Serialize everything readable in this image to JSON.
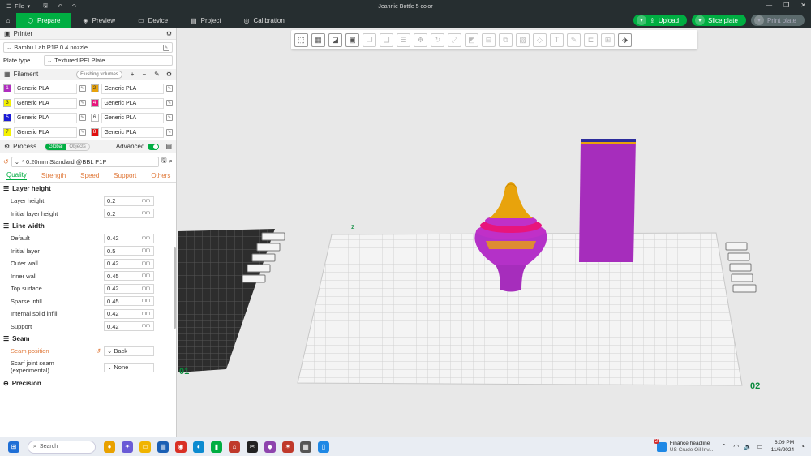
{
  "window": {
    "title": "Jeannie Bottle 5 color",
    "file_menu": "File"
  },
  "nav": {
    "tabs": [
      {
        "label": "Prepare",
        "icon": "cube-icon"
      },
      {
        "label": "Preview",
        "icon": "layers-icon"
      },
      {
        "label": "Device",
        "icon": "monitor-icon"
      },
      {
        "label": "Project",
        "icon": "project-icon"
      },
      {
        "label": "Calibration",
        "icon": "calibration-icon"
      }
    ],
    "upload": "Upload",
    "slice_plate": "Slice plate",
    "print_plate": "Print plate"
  },
  "printer": {
    "header": "Printer",
    "printer_name": "Bambu Lab P1P 0.4 nozzle",
    "plate_type_label": "Plate type",
    "plate_type_value": "Textured PEI Plate"
  },
  "filament": {
    "header": "Filament",
    "flushing": "Flushing volumes",
    "slots": [
      {
        "num": "1",
        "name": "Generic PLA",
        "color": "#b02ec0"
      },
      {
        "num": "2",
        "name": "Generic PLA",
        "color": "#e8a30c"
      },
      {
        "num": "3",
        "name": "Generic PLA",
        "color": "#f5f200"
      },
      {
        "num": "4",
        "name": "Generic PLA",
        "color": "#e8157c"
      },
      {
        "num": "5",
        "name": "Generic PLA",
        "color": "#1b1bd6"
      },
      {
        "num": "6",
        "name": "Generic PLA",
        "color": "#ffffff"
      },
      {
        "num": "7",
        "name": "Generic PLA",
        "color": "#f5f200"
      },
      {
        "num": "8",
        "name": "Generic PLA",
        "color": "#e01010"
      }
    ]
  },
  "process": {
    "header": "Process",
    "global": "Global",
    "objects": "Objects",
    "advanced": "Advanced",
    "preset": "* 0.20mm Standard @BBL P1P",
    "tabs": [
      "Quality",
      "Strength",
      "Speed",
      "Support",
      "Others"
    ]
  },
  "settings": {
    "layer_height": {
      "title": "Layer height",
      "rows": [
        {
          "label": "Layer height",
          "value": "0.2",
          "unit": "mm"
        },
        {
          "label": "Initial layer height",
          "value": "0.2",
          "unit": "mm"
        }
      ]
    },
    "line_width": {
      "title": "Line width",
      "rows": [
        {
          "label": "Default",
          "value": "0.42",
          "unit": "mm"
        },
        {
          "label": "Initial layer",
          "value": "0.5",
          "unit": "mm"
        },
        {
          "label": "Outer wall",
          "value": "0.42",
          "unit": "mm"
        },
        {
          "label": "Inner wall",
          "value": "0.45",
          "unit": "mm"
        },
        {
          "label": "Top surface",
          "value": "0.42",
          "unit": "mm"
        },
        {
          "label": "Sparse infill",
          "value": "0.45",
          "unit": "mm"
        },
        {
          "label": "Internal solid infill",
          "value": "0.42",
          "unit": "mm"
        },
        {
          "label": "Support",
          "value": "0.42",
          "unit": "mm"
        }
      ]
    },
    "seam": {
      "title": "Seam",
      "position_label": "Seam position",
      "position_value": "Back",
      "scarf_label": "Scarf joint seam (experimental)",
      "scarf_value": "None"
    },
    "precision": {
      "title": "Precision"
    }
  },
  "viewport": {
    "plate_label_left": "01",
    "plate_label_right": "02"
  },
  "taskbar": {
    "search": "Search",
    "news_title": "Finance headline",
    "news_sub": "US Crude Oil Inv...",
    "news_badge": "2",
    "time": "6:09 PM",
    "date": "11/6/2024"
  }
}
